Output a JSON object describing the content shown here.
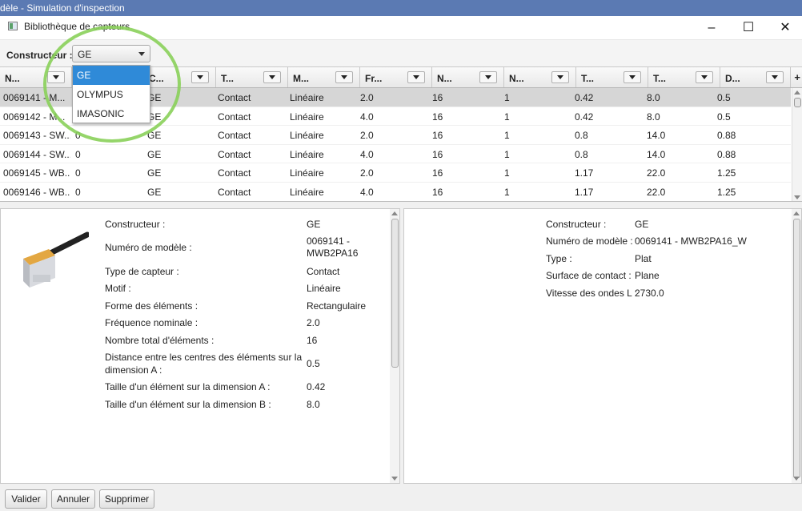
{
  "outer_title": "dèle - Simulation d'inspection",
  "window": {
    "title": "Bibliothèque de capteurs"
  },
  "toolbar": {
    "constructeur_label": "Constructeur :",
    "combo_value": "GE",
    "dropdown_options": [
      "GE",
      "OLYMPUS",
      "IMASONIC"
    ]
  },
  "table": {
    "headers": [
      "N...",
      "...",
      "C...",
      "T...",
      "M...",
      "Fr...",
      "N...",
      "N...",
      "T...",
      "T...",
      "D..."
    ],
    "rows": [
      [
        "0069141 - M...",
        "0",
        "GE",
        "Contact",
        "Linéaire",
        "2.0",
        "16",
        "1",
        "0.42",
        "8.0",
        "0.5"
      ],
      [
        "0069142 - M...",
        "0",
        "GE",
        "Contact",
        "Linéaire",
        "4.0",
        "16",
        "1",
        "0.42",
        "8.0",
        "0.5"
      ],
      [
        "0069143 - SW...",
        "0",
        "GE",
        "Contact",
        "Linéaire",
        "2.0",
        "16",
        "1",
        "0.8",
        "14.0",
        "0.88"
      ],
      [
        "0069144 - SW...",
        "0",
        "GE",
        "Contact",
        "Linéaire",
        "4.0",
        "16",
        "1",
        "0.8",
        "14.0",
        "0.88"
      ],
      [
        "0069145 - WB...",
        "0",
        "GE",
        "Contact",
        "Linéaire",
        "2.0",
        "16",
        "1",
        "1.17",
        "22.0",
        "1.25"
      ],
      [
        "0069146 - WB...",
        "0",
        "GE",
        "Contact",
        "Linéaire",
        "4.0",
        "16",
        "1",
        "1.17",
        "22.0",
        "1.25"
      ]
    ]
  },
  "details_left": {
    "labels": {
      "constructeur": "Constructeur :",
      "modele": "Numéro de modèle :",
      "type": "Type de capteur :",
      "motif": "Motif :",
      "forme": "Forme des éléments :",
      "freq": "Fréquence nominale :",
      "nombre": "Nombre total d'éléments :",
      "distance_l1": "Distance entre les centres des éléments sur la",
      "distance_l2": "dimension A :",
      "tailleA": "Taille d'un élément sur la dimension A :",
      "tailleB": "Taille d'un élément sur la dimension B :"
    },
    "values": {
      "constructeur": "GE",
      "modele_l1": "0069141 -",
      "modele_l2": "MWB2PA16",
      "type": "Contact",
      "motif": "Linéaire",
      "forme": "Rectangulaire",
      "freq": "2.0",
      "nombre": "16",
      "distance": "0.5",
      "tailleA": "0.42",
      "tailleB": "8.0"
    }
  },
  "details_right": {
    "labels": {
      "constructeur": "Constructeur :",
      "modele": "Numéro de modèle :",
      "type": "Type :",
      "surface": "Surface de contact :",
      "vitesse": "Vitesse des ondes L :"
    },
    "values": {
      "constructeur": "GE",
      "modele": "0069141 - MWB2PA16_W",
      "type": "Plat",
      "surface": "Plane",
      "vitesse": "2730.0"
    }
  },
  "buttons": {
    "valider": "Valider",
    "annuler": "Annuler",
    "supprimer": "Supprimer"
  },
  "colors": {
    "highlight_circle": "#8ad05a",
    "selection": "#2f8ad8"
  }
}
